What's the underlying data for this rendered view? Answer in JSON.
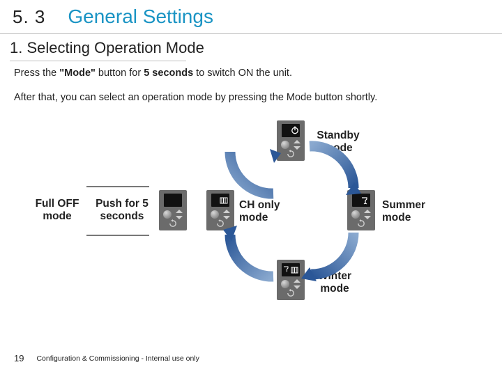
{
  "header": {
    "section_number": "5. 3",
    "section_title": "General Settings"
  },
  "subheading": "1. Selecting Operation Mode",
  "body": {
    "line1_pre": "Press the ",
    "line1_bold1": "\"Mode\"",
    "line1_mid": " button for ",
    "line1_bold2": "5 seconds",
    "line1_post": " to switch ON the unit.",
    "line2": "After that, you can select an operation mode by pressing the Mode button shortly."
  },
  "labels": {
    "full_off_l1": "Full OFF",
    "full_off_l2": "mode",
    "push_l1": "Push for 5",
    "push_l2": "seconds",
    "standby_l1": "Standby",
    "standby_l2": "mode",
    "ch_only_l1": "CH only",
    "ch_only_l2": "mode",
    "summer_l1": "Summer",
    "summer_l2": "mode",
    "winter_l1": "Winter",
    "winter_l2": "mode"
  },
  "footer": {
    "page_number": "19",
    "text": "Configuration & Commissioning - Internal use only"
  },
  "icons": {
    "standby": "standby",
    "faucet": "faucet",
    "radiator": "radiator",
    "faucet_radiator": "faucet_radiator"
  },
  "colors": {
    "accent": "#1a94c4",
    "arrow": "#335f9a"
  }
}
